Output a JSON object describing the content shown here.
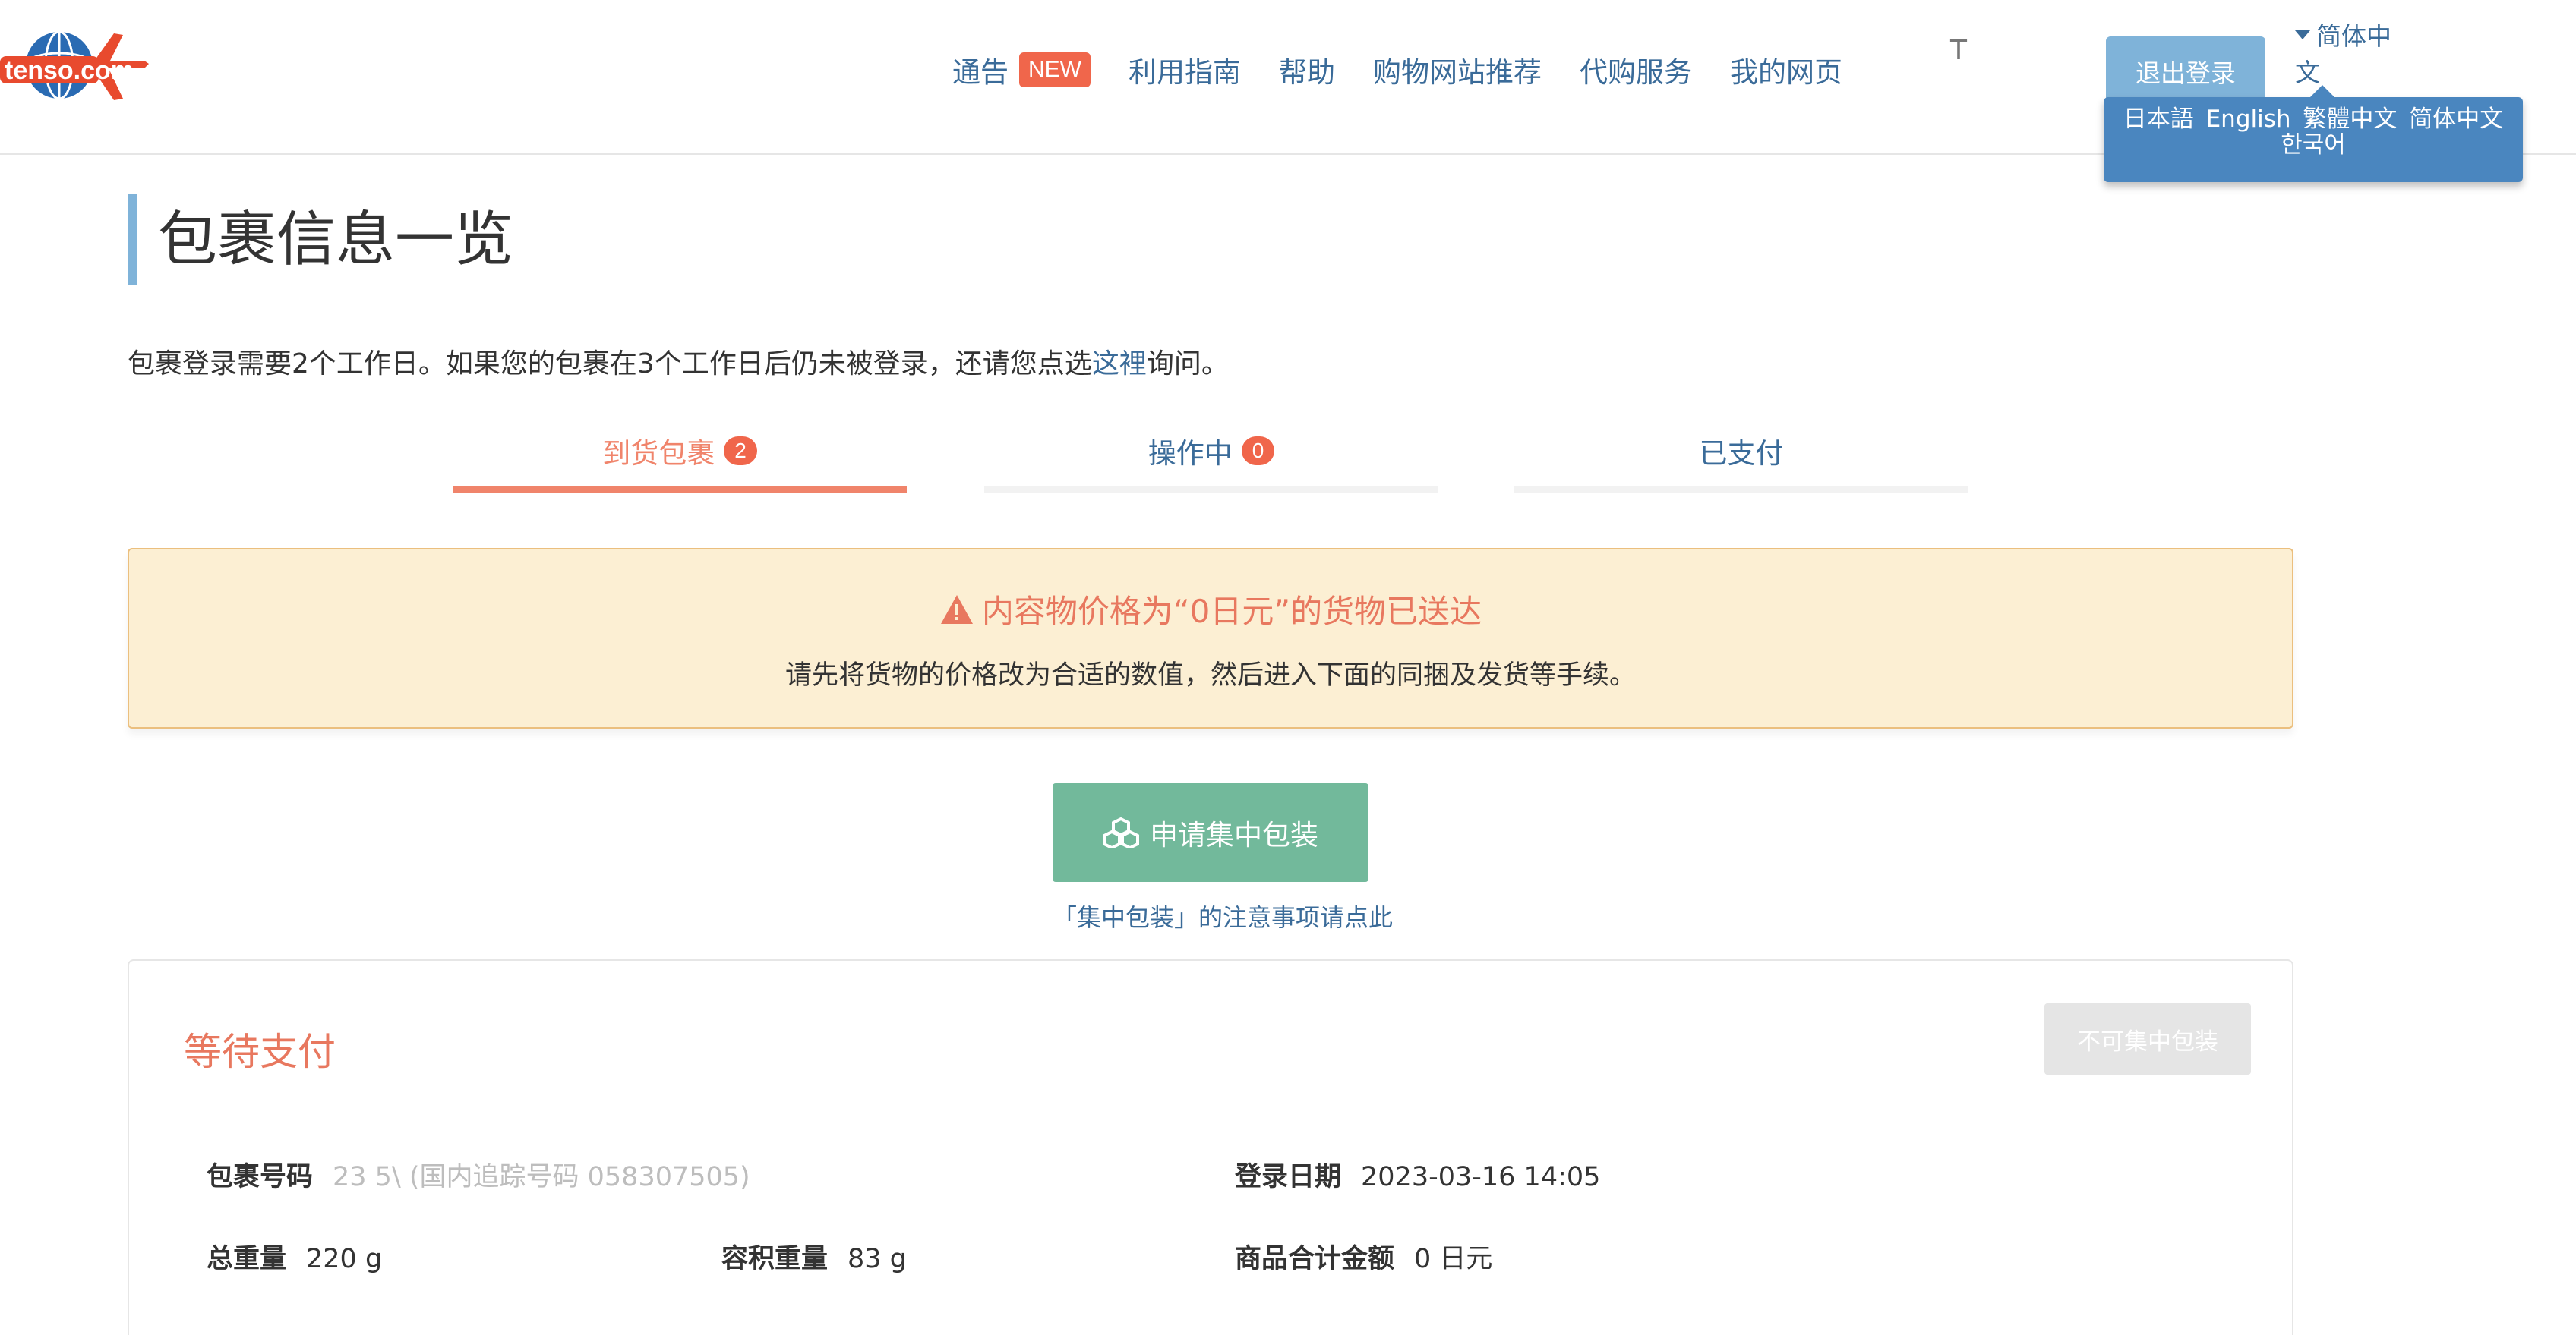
{
  "header": {
    "logo_text": "tenso.com",
    "nav": [
      {
        "label": "通告",
        "badge": "NEW"
      },
      {
        "label": "利用指南"
      },
      {
        "label": "帮助"
      },
      {
        "label": "购物网站推荐"
      },
      {
        "label": "代购服务"
      },
      {
        "label": "我的网页"
      }
    ],
    "user_name_fragment": "T",
    "logout_label": "退出登录",
    "language_current": "简体中文",
    "language_options": [
      "日本語",
      "English",
      "繁體中文",
      "简体中文",
      "한국어"
    ]
  },
  "page": {
    "title": "包裹信息一览",
    "notice_before": "包裹登录需要2个工作日。如果您的包裹在3个工作日后仍未被登录，还请您点选",
    "notice_link": "这裡",
    "notice_after": "询问。"
  },
  "tabs": [
    {
      "label": "到货包裹",
      "count": "2",
      "active": true
    },
    {
      "label": "操作中",
      "count": "0",
      "active": false
    },
    {
      "label": "已支付",
      "count": null,
      "active": false
    }
  ],
  "warning": {
    "title": "内容物价格为“0日元”的货物已送达",
    "description": "请先将货物的价格改为合适的数值，然后进入下面的同捆及发货等手续。"
  },
  "consolidate": {
    "button_label": "申请集中包装",
    "note_link": "「集中包装」的注意事项请点此"
  },
  "card": {
    "status": "等待支付",
    "disabled_button": "不可集中包装",
    "package_number_label": "包裹号码",
    "package_number_value": "23 5\\ (国内追踪号码 058307505)",
    "register_date_label": "登录日期",
    "register_date_value": "2023-03-16 14:05",
    "total_weight_label": "总重量",
    "total_weight_value": "220 g",
    "volume_weight_label": "容积重量",
    "volume_weight_value": "83 g",
    "total_amount_label": "商品合计金额",
    "total_amount_value": "0 日元"
  },
  "colors": {
    "link_blue": "#3a6b99",
    "accent_orange": "#f0846b",
    "badge_red": "#f0664b",
    "logout_blue": "#7fb3d9",
    "lang_menu_blue": "#4a86bf",
    "warning_bg": "#fcefd3",
    "warning_border": "#ebbf7e",
    "consolidate_green": "#72b99b"
  },
  "icons": {
    "logo": "tenso-globe-airplane-logo",
    "warning": "warning-triangle-icon",
    "consolidate": "boxes-icon",
    "language": "caret-down-icon"
  }
}
